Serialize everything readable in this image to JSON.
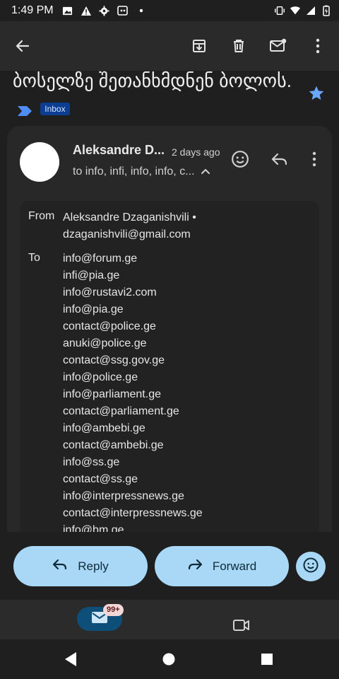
{
  "status_bar": {
    "time": "1:49 PM"
  },
  "email": {
    "subject": "ბოსელზე შეთანხმდნენ ბოლოს.",
    "label": "Inbox",
    "sender_name": "Aleksandre D...",
    "time_ago": "2 days ago",
    "recipients_summary": "to info, infi, info, info, c..."
  },
  "details": {
    "from_label": "From",
    "from_value": "Aleksandre Dzaganishvili • dzaganishvili@gmail.com",
    "to_label": "To",
    "to_list": [
      "info@forum.ge",
      "infi@pia.ge",
      "info@rustavi2.com",
      "info@pia.ge",
      "contact@police.ge",
      "anuki@police.ge",
      "contact@ssg.gov.ge",
      "info@police.ge",
      "info@parliament.ge",
      "contact@parliament.ge",
      "info@ambebi.ge",
      "contact@ambebi.ge",
      "info@ss.ge",
      "contact@ss.ge",
      "info@interpressnews.ge",
      "contact@interpressnews.ge",
      "info@bm.ge"
    ]
  },
  "actions": {
    "reply_label": "Reply",
    "forward_label": "Forward"
  },
  "bottom_nav": {
    "mail_badge": "99+"
  },
  "colors": {
    "accent": "#a8d8f6",
    "star": "#6aa7ff",
    "label_chevron": "#4f8df5",
    "inbox_badge_bg": "#0b3d91"
  },
  "icons": [
    "back-arrow-icon",
    "archive-icon",
    "delete-icon",
    "mark-unread-icon",
    "more-vert-icon",
    "star-icon",
    "label-chevron-icon",
    "emoji-icon",
    "reply-icon",
    "forward-icon",
    "mail-icon",
    "video-icon"
  ]
}
